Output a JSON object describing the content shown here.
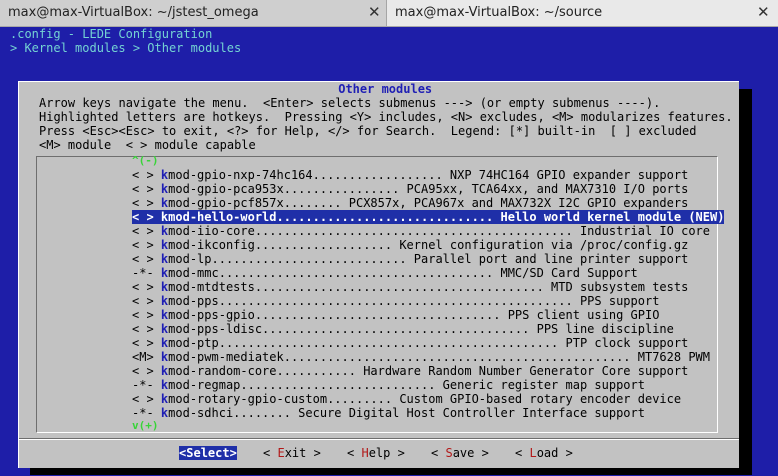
{
  "tabs": [
    {
      "label": "max@max-VirtualBox: ~/jstest_omega",
      "close": "✕"
    },
    {
      "label": "max@max-VirtualBox: ~/source",
      "close": "✕"
    }
  ],
  "terminal": {
    "title": ".config - LEDE Configuration",
    "breadcrumb": "> Kernel modules > Other modules"
  },
  "dialog": {
    "title": " Other modules ",
    "help_lines": [
      "Arrow keys navigate the menu.  <Enter> selects submenus ---> (or empty submenus ----).",
      "Highlighted letters are hotkeys.  Pressing <Y> includes, <N> excludes, <M> modularizes features.",
      "Press <Esc><Esc> to exit, <?> for Help, </> for Search.  Legend: [*] built-in  [ ] excluded",
      "<M> module  < > module capable"
    ],
    "scroll_up": "^(-)",
    "scroll_down": "v(+)",
    "items": [
      {
        "state": "< >",
        "hotkey": "k",
        "text": "mod-gpio-nxp-74hc164.................. NXP 74HC164 GPIO expander support"
      },
      {
        "state": "< >",
        "hotkey": "k",
        "text": "mod-gpio-pca953x................ PCA95xx, TCA64xx, and MAX7310 I/O ports"
      },
      {
        "state": "< >",
        "hotkey": "k",
        "text": "mod-gpio-pcf857x........ PCX857x, PCA967x and MAX732X I2C GPIO expanders"
      },
      {
        "state": "< >",
        "hotkey": "k",
        "text": "mod-hello-world.............................. Hello world kernel module (NEW)",
        "selected": true
      },
      {
        "state": "< >",
        "hotkey": "k",
        "text": "mod-iio-core............................................ Industrial IO core"
      },
      {
        "state": "< >",
        "hotkey": "k",
        "text": "mod-ikconfig................... Kernel configuration via /proc/config.gz"
      },
      {
        "state": "< >",
        "hotkey": "k",
        "text": "mod-lp........................... Parallel port and line printer support"
      },
      {
        "state": "-*-",
        "hotkey": "k",
        "text": "mod-mmc...................................... MMC/SD Card Support"
      },
      {
        "state": "< >",
        "hotkey": "k",
        "text": "mod-mtdtests........................................ MTD subsystem tests"
      },
      {
        "state": "< >",
        "hotkey": "k",
        "text": "mod-pps................................................. PPS support"
      },
      {
        "state": "< >",
        "hotkey": "k",
        "text": "mod-pps-gpio.................................. PPS client using GPIO"
      },
      {
        "state": "< >",
        "hotkey": "k",
        "text": "mod-pps-ldisc..................................... PPS line discipline"
      },
      {
        "state": "< >",
        "hotkey": "k",
        "text": "mod-ptp............................................... PTP clock support"
      },
      {
        "state": "<M>",
        "hotkey": "k",
        "text": "mod-pwm-mediatek................................................ MT7628 PWM"
      },
      {
        "state": "< >",
        "hotkey": "k",
        "text": "mod-random-core........... Hardware Random Number Generator Core support"
      },
      {
        "state": "-*-",
        "hotkey": "k",
        "text": "mod-regmap........................... Generic register map support"
      },
      {
        "state": "< >",
        "hotkey": "k",
        "text": "mod-rotary-gpio-custom......... Custom GPIO-based rotary encoder device"
      },
      {
        "state": "-*-",
        "hotkey": "k",
        "text": "mod-sdhci........ Secure Digital Host Controller Interface support"
      }
    ],
    "buttons": [
      {
        "open": "<",
        "hot": "S",
        "rest": "elect",
        "close": ">",
        "active": true
      },
      {
        "open": "< ",
        "hot": "E",
        "rest": "xit",
        "close": " >",
        "active": false
      },
      {
        "open": "< ",
        "hot": "H",
        "rest": "elp",
        "close": " >",
        "active": false
      },
      {
        "open": "< ",
        "hot": "S",
        "rest": "ave",
        "close": " >",
        "active": false
      },
      {
        "open": "< ",
        "hot": "L",
        "rest": "oad",
        "close": " >",
        "active": false
      }
    ]
  },
  "colors": {
    "terminal_bg": "#1e1ea8",
    "dialog_bg": "#c2c2c2",
    "selection_bg": "#1f2fa8",
    "hotkey": "#1f1fb4",
    "scroll_arrow": "#38d438",
    "button_hotkey": "#b21818"
  }
}
